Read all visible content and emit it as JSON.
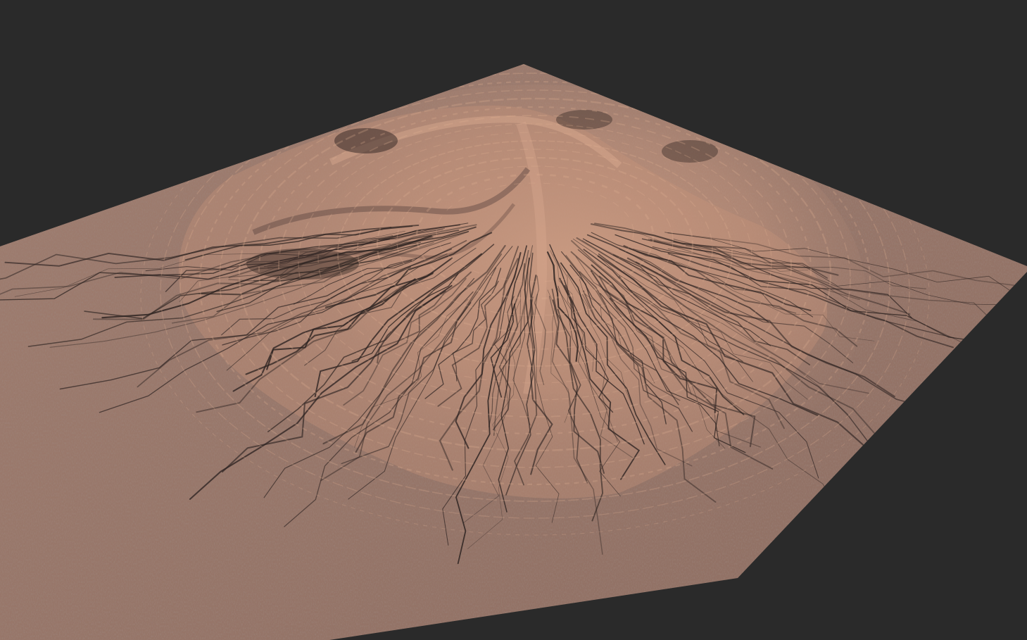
{
  "scene": {
    "background_color": "#2a2a2a",
    "terrain": {
      "kind": "eroded-mountain-heightfield",
      "base_color": "#9a7a6c",
      "highlight_color": "#d8a88c",
      "shadow_color": "#5a4640",
      "gully_color": "#2e2422"
    }
  }
}
